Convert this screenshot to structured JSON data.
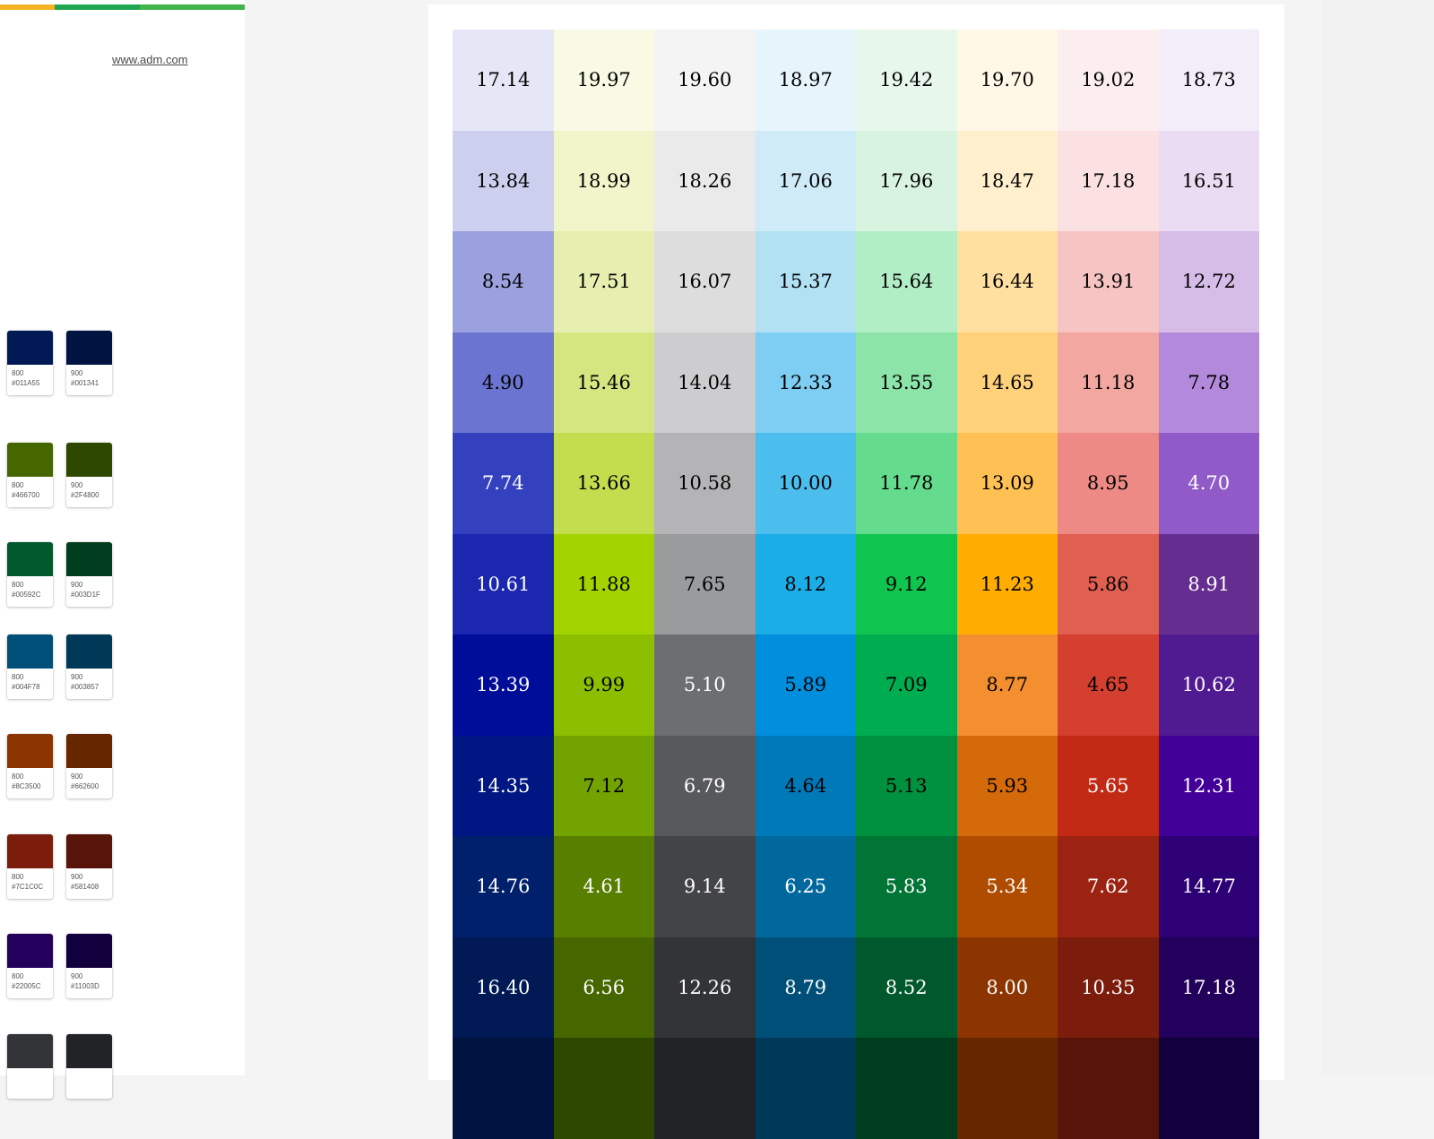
{
  "site": {
    "url": "www.adm.com"
  },
  "swatches": [
    {
      "level": "800",
      "hex": "#011A55",
      "color": "#011A55"
    },
    {
      "level": "900",
      "hex": "#001341",
      "color": "#001341"
    },
    {
      "level": "800",
      "hex": "#466700",
      "color": "#466700"
    },
    {
      "level": "900",
      "hex": "#2F4800",
      "color": "#2F4800"
    },
    {
      "level": "800",
      "hex": "#00592C",
      "color": "#00592C"
    },
    {
      "level": "900",
      "hex": "#003D1F",
      "color": "#003D1F"
    },
    {
      "level": "800",
      "hex": "#004F78",
      "color": "#004F78"
    },
    {
      "level": "900",
      "hex": "#003857",
      "color": "#003857"
    },
    {
      "level": "800",
      "hex": "#8C3500",
      "color": "#8C3500"
    },
    {
      "level": "900",
      "hex": "#662600",
      "color": "#662600"
    },
    {
      "level": "800",
      "hex": "#7C1C0C",
      "color": "#7C1C0C"
    },
    {
      "level": "900",
      "hex": "#581408",
      "color": "#581408"
    },
    {
      "level": "800",
      "hex": "#22005C",
      "color": "#22005C"
    },
    {
      "level": "900",
      "hex": "#11003D",
      "color": "#11003D"
    },
    {
      "level": "",
      "hex": "",
      "color": "#333438"
    },
    {
      "level": "",
      "hex": "",
      "color": "#222327"
    }
  ],
  "contrast_table": {
    "rows": [
      {
        "cells": [
          {
            "value": "17.14",
            "bg": "#E6E7F6",
            "fg": "#000000"
          },
          {
            "value": "19.97",
            "bg": "#F8FAE4",
            "fg": "#000000"
          },
          {
            "value": "19.60",
            "bg": "#F4F4F4",
            "fg": "#000000"
          },
          {
            "value": "18.97",
            "bg": "#E6F4FB",
            "fg": "#000000"
          },
          {
            "value": "19.42",
            "bg": "#E8F7EC",
            "fg": "#000000"
          },
          {
            "value": "19.70",
            "bg": "#FFF8E6",
            "fg": "#000000"
          },
          {
            "value": "19.02",
            "bg": "#FCEEEE",
            "fg": "#000000"
          },
          {
            "value": "18.73",
            "bg": "#F2EDF8",
            "fg": "#000000"
          }
        ]
      },
      {
        "cells": [
          {
            "value": "13.84",
            "bg": "#CDCFEE",
            "fg": "#000000"
          },
          {
            "value": "18.99",
            "bg": "#F1F6CA",
            "fg": "#000000"
          },
          {
            "value": "18.26",
            "bg": "#EAEAEA",
            "fg": "#000000"
          },
          {
            "value": "17.06",
            "bg": "#CFEBF8",
            "fg": "#000000"
          },
          {
            "value": "17.96",
            "bg": "#D8F3DF",
            "fg": "#000000"
          },
          {
            "value": "18.47",
            "bg": "#FFEFCC",
            "fg": "#000000"
          },
          {
            "value": "17.18",
            "bg": "#FBE1E1",
            "fg": "#000000"
          },
          {
            "value": "16.51",
            "bg": "#EADCF3",
            "fg": "#000000"
          }
        ]
      },
      {
        "cells": [
          {
            "value": "8.54",
            "bg": "#9BA1DF",
            "fg": "#000000"
          },
          {
            "value": "17.51",
            "bg": "#E6EFB0",
            "fg": "#000000"
          },
          {
            "value": "16.07",
            "bg": "#DDDDDE",
            "fg": "#000000"
          },
          {
            "value": "15.37",
            "bg": "#B2E1F4",
            "fg": "#000000"
          },
          {
            "value": "15.64",
            "bg": "#B1EDC5",
            "fg": "#000000"
          },
          {
            "value": "16.44",
            "bg": "#FFE0A0",
            "fg": "#000000"
          },
          {
            "value": "13.91",
            "bg": "#F6C4C3",
            "fg": "#000000"
          },
          {
            "value": "12.72",
            "bg": "#D6BDE8",
            "fg": "#000000"
          }
        ]
      },
      {
        "cells": [
          {
            "value": "4.90",
            "bg": "#6B75D1",
            "fg": "#000000"
          },
          {
            "value": "15.46",
            "bg": "#D5E57F",
            "fg": "#000000"
          },
          {
            "value": "14.04",
            "bg": "#CDCDCF",
            "fg": "#000000"
          },
          {
            "value": "12.33",
            "bg": "#7DCEF2",
            "fg": "#000000"
          },
          {
            "value": "13.55",
            "bg": "#8CE4A9",
            "fg": "#000000"
          },
          {
            "value": "14.65",
            "bg": "#FFD17A",
            "fg": "#000000"
          },
          {
            "value": "11.18",
            "bg": "#F2A7A1",
            "fg": "#000000"
          },
          {
            "value": "7.78",
            "bg": "#B38ADB",
            "fg": "#000000"
          }
        ]
      },
      {
        "cells": [
          {
            "value": "7.74",
            "bg": "#3341BE",
            "fg": "#FFFFFF"
          },
          {
            "value": "13.66",
            "bg": "#C2DD4E",
            "fg": "#000000"
          },
          {
            "value": "10.58",
            "bg": "#B4B4B6",
            "fg": "#000000"
          },
          {
            "value": "10.00",
            "bg": "#4BBEEE",
            "fg": "#000000"
          },
          {
            "value": "11.78",
            "bg": "#65DB8E",
            "fg": "#000000"
          },
          {
            "value": "13.09",
            "bg": "#FFC153",
            "fg": "#000000"
          },
          {
            "value": "8.95",
            "bg": "#EE8A85",
            "fg": "#000000"
          },
          {
            "value": "4.70",
            "bg": "#905AC8",
            "fg": "#FFFFFF"
          }
        ]
      },
      {
        "cells": [
          {
            "value": "10.61",
            "bg": "#1B27AF",
            "fg": "#FFFFFF"
          },
          {
            "value": "11.88",
            "bg": "#A4D400",
            "fg": "#000000"
          },
          {
            "value": "7.65",
            "bg": "#9A9B9D",
            "fg": "#000000"
          },
          {
            "value": "8.12",
            "bg": "#1BADE8",
            "fg": "#000000"
          },
          {
            "value": "9.12",
            "bg": "#0FC54F",
            "fg": "#000000"
          },
          {
            "value": "11.23",
            "bg": "#FFAD00",
            "fg": "#000000"
          },
          {
            "value": "5.86",
            "bg": "#E05F51",
            "fg": "#000000"
          },
          {
            "value": "8.91",
            "bg": "#652D90",
            "fg": "#FFFFFF"
          }
        ]
      },
      {
        "cells": [
          {
            "value": "13.39",
            "bg": "#000D99",
            "fg": "#FFFFFF"
          },
          {
            "value": "9.99",
            "bg": "#8DBF00",
            "fg": "#000000"
          },
          {
            "value": "5.10",
            "bg": "#6D6E71",
            "fg": "#FFFFFF"
          },
          {
            "value": "5.89",
            "bg": "#008EDD",
            "fg": "#000000"
          },
          {
            "value": "7.09",
            "bg": "#00AC50",
            "fg": "#000000"
          },
          {
            "value": "8.77",
            "bg": "#F48F30",
            "fg": "#000000"
          },
          {
            "value": "4.65",
            "bg": "#D53F2F",
            "fg": "#000000"
          },
          {
            "value": "10.62",
            "bg": "#501A91",
            "fg": "#FFFFFF"
          }
        ]
      },
      {
        "cells": [
          {
            "value": "14.35",
            "bg": "#001783",
            "fg": "#FFFFFF"
          },
          {
            "value": "7.12",
            "bg": "#72A300",
            "fg": "#000000"
          },
          {
            "value": "6.79",
            "bg": "#58595B",
            "fg": "#FFFFFF"
          },
          {
            "value": "4.64",
            "bg": "#0079B9",
            "fg": "#000000"
          },
          {
            "value": "5.13",
            "bg": "#00913F",
            "fg": "#000000"
          },
          {
            "value": "5.93",
            "bg": "#D46A0A",
            "fg": "#000000"
          },
          {
            "value": "5.65",
            "bg": "#C32A16",
            "fg": "#FFFFFF"
          },
          {
            "value": "12.31",
            "bg": "#430099",
            "fg": "#FFFFFF"
          }
        ]
      },
      {
        "cells": [
          {
            "value": "14.76",
            "bg": "#00206B",
            "fg": "#FFFFFF"
          },
          {
            "value": "4.61",
            "bg": "#587F00",
            "fg": "#FFFFFF"
          },
          {
            "value": "9.14",
            "bg": "#434447",
            "fg": "#FFFFFF"
          },
          {
            "value": "6.25",
            "bg": "#00689D",
            "fg": "#FFFFFF"
          },
          {
            "value": "5.83",
            "bg": "#007535",
            "fg": "#FFFFFF"
          },
          {
            "value": "5.34",
            "bg": "#B04C00",
            "fg": "#FFFFFF"
          },
          {
            "value": "7.62",
            "bg": "#9C2211",
            "fg": "#FFFFFF"
          },
          {
            "value": "14.77",
            "bg": "#2D0075",
            "fg": "#FFFFFF"
          }
        ]
      },
      {
        "cells": [
          {
            "value": "16.40",
            "bg": "#011A55",
            "fg": "#FFFFFF"
          },
          {
            "value": "6.56",
            "bg": "#466700",
            "fg": "#FFFFFF"
          },
          {
            "value": "12.26",
            "bg": "#333438",
            "fg": "#FFFFFF"
          },
          {
            "value": "8.79",
            "bg": "#004F78",
            "fg": "#FFFFFF"
          },
          {
            "value": "8.52",
            "bg": "#00592C",
            "fg": "#FFFFFF"
          },
          {
            "value": "8.00",
            "bg": "#8C3500",
            "fg": "#FFFFFF"
          },
          {
            "value": "10.35",
            "bg": "#7C1C0C",
            "fg": "#FFFFFF"
          },
          {
            "value": "17.18",
            "bg": "#22005C",
            "fg": "#FFFFFF"
          }
        ]
      },
      {
        "cells": [
          {
            "value": "",
            "bg": "#001341",
            "fg": "#FFFFFF"
          },
          {
            "value": "",
            "bg": "#2F4800",
            "fg": "#FFFFFF"
          },
          {
            "value": "",
            "bg": "#222327",
            "fg": "#FFFFFF"
          },
          {
            "value": "",
            "bg": "#003857",
            "fg": "#FFFFFF"
          },
          {
            "value": "",
            "bg": "#003D1F",
            "fg": "#FFFFFF"
          },
          {
            "value": "",
            "bg": "#662600",
            "fg": "#FFFFFF"
          },
          {
            "value": "",
            "bg": "#581408",
            "fg": "#FFFFFF"
          },
          {
            "value": "",
            "bg": "#11003D",
            "fg": "#FFFFFF"
          }
        ]
      }
    ]
  }
}
